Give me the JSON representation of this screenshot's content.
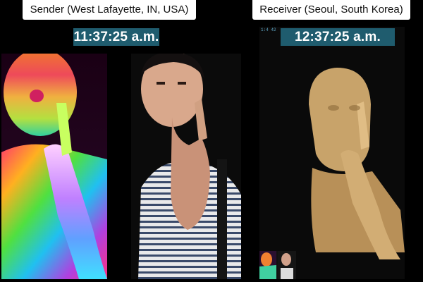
{
  "sender": {
    "label": "Sender (West Lafayette, IN, USA)",
    "clock": "11:37:25 a.m."
  },
  "receiver": {
    "label": "Receiver (Seoul, South Korea)",
    "clock": "12:37:25 a.m.",
    "corner_note": "1:4 42"
  },
  "colors": {
    "clock_bg": "#1f5c6e",
    "label_bg": "#ffffff",
    "background": "#000000",
    "reconstruction_tone": "#c8a36a"
  }
}
